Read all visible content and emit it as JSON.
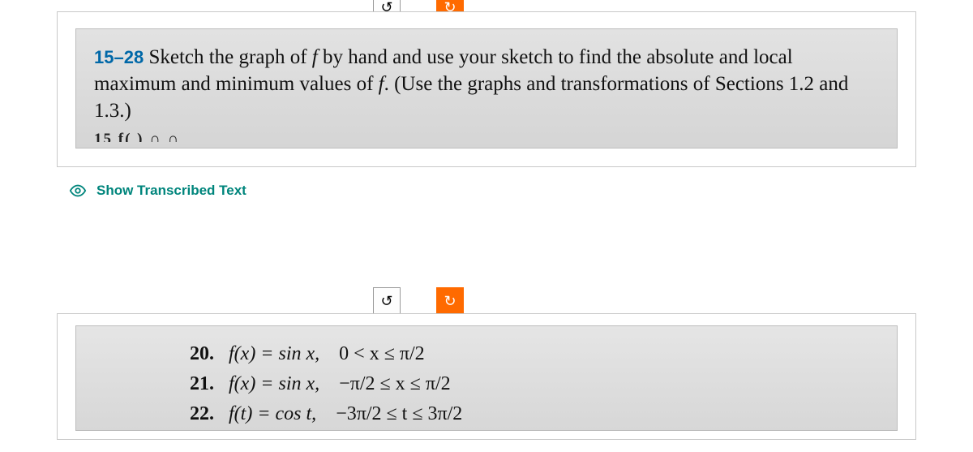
{
  "toolbar": {
    "undo_glyph": "↺",
    "redo_glyph": "↻"
  },
  "block1": {
    "section_range": "15–28",
    "text_part1": " Sketch the graph of ",
    "text_f": "f",
    "text_part2": " by hand and use your sketch to find the absolute and local maximum and minimum values of ",
    "text_f2": "f",
    "text_part3": ". (Use the graphs and transformations of Sections 1.2 and 1.3.)",
    "cutoff": "15   f(  )     ∩     ∩"
  },
  "show_transcribed_label": "Show Transcribed Text",
  "problems": [
    {
      "num": "20.",
      "func": "f(x) = sin x,",
      "domain": "0 < x ≤ π/2"
    },
    {
      "num": "21.",
      "func": "f(x) = sin x,",
      "domain": "−π/2 ≤ x ≤ π/2"
    },
    {
      "num": "22.",
      "func": "f(t) = cos t,",
      "domain": "−3π/2 ≤ t ≤ 3π/2"
    }
  ]
}
